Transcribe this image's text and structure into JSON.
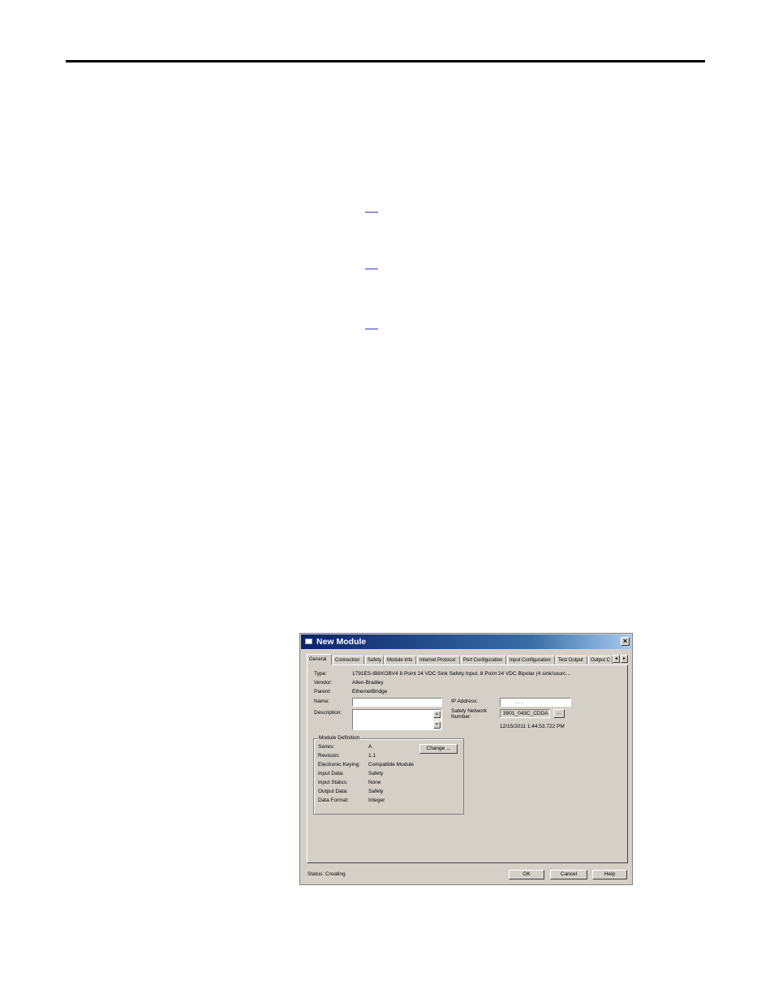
{
  "dialog": {
    "title": "New Module",
    "close_glyph": "×",
    "tabs": [
      {
        "label": "General",
        "active": true
      },
      {
        "label": "Connection"
      },
      {
        "label": "Safety"
      },
      {
        "label": "Module Info"
      },
      {
        "label": "Internet Protocol"
      },
      {
        "label": "Port Configuration"
      },
      {
        "label": "Input Configuration"
      },
      {
        "label": "Test Output"
      },
      {
        "label": "Output C"
      }
    ],
    "tab_scroll": {
      "left": "◂",
      "right": "▸"
    },
    "general": {
      "type_label": "Type:",
      "type_value": "1791ES-IB8XOBV4 8 Point 24 VDC Sink Safety Input, 8 Point 24 VDC Bipolar (4 sink/sourc...",
      "vendor_label": "Vendor:",
      "vendor_value": "Allen-Bradley",
      "parent_label": "Parent:",
      "parent_value": "EthernetBridge",
      "name_label": "Name:",
      "name_value": "",
      "description_label": "Description:",
      "description_value": "",
      "ip_label": "IP Address:",
      "ip_value": ".        .        .",
      "snn_label_1": "Safety Network",
      "snn_label_2": "Number:",
      "snn_value": "3901_043C_CDDA",
      "snn_button": "...",
      "snn_timestamp": "12/15/2011 1:44:53.722 PM"
    },
    "module_definition": {
      "legend": "Module Definition",
      "change_button": "Change ...",
      "rows": [
        {
          "label": "Series:",
          "value": "A"
        },
        {
          "label": "Revision:",
          "value": "1.1"
        },
        {
          "label": "Electronic Keying:",
          "value": "Compatible Module"
        },
        {
          "label": "Input Data:",
          "value": "Safety"
        },
        {
          "label": "Input Status:",
          "value": "None"
        },
        {
          "label": "Output Data:",
          "value": "Safety"
        },
        {
          "label": "Data Format:",
          "value": "Integer"
        }
      ]
    },
    "status_text": "Status:  Creating",
    "buttons": {
      "ok": "OK",
      "cancel": "Cancel",
      "help": "Help"
    }
  }
}
